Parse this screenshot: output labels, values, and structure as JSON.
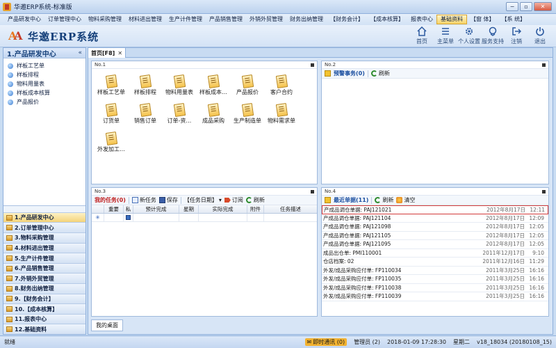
{
  "window": {
    "title": "华邀ERP系统-标准版",
    "buttons": [
      "−",
      "▫",
      "✕"
    ]
  },
  "menu": [
    {
      "label": "产品研发中心",
      "active": false
    },
    {
      "label": "订单管理中心",
      "active": false
    },
    {
      "label": "物料采购管理",
      "active": false
    },
    {
      "label": "材料进出管理",
      "active": false
    },
    {
      "label": "生产计件管理",
      "active": false
    },
    {
      "label": "产品销售管理",
      "active": false
    },
    {
      "label": "外销外贸管理",
      "active": false
    },
    {
      "label": "财务出纳管理",
      "active": false
    },
    {
      "label": "【财务会计】",
      "active": false
    },
    {
      "label": "【成本核算】",
      "active": false
    },
    {
      "label": "报表中心",
      "active": false
    },
    {
      "label": "基础资料",
      "active": true
    },
    {
      "label": "【窗 体】",
      "active": false
    },
    {
      "label": "【系 统】",
      "active": false
    }
  ],
  "logo": {
    "text": "华邀ERP系统"
  },
  "toolbar": [
    {
      "label": "首页",
      "icon": "home-icon"
    },
    {
      "label": "主菜单",
      "icon": "menu-icon"
    },
    {
      "label": "个人设置",
      "icon": "gear-icon"
    },
    {
      "label": "服务支持",
      "icon": "support-icon"
    },
    {
      "label": "注销",
      "icon": "logout-icon"
    },
    {
      "label": "退出",
      "icon": "power-icon"
    }
  ],
  "sidebar": {
    "title": "1.产品研发中心",
    "collapse": "«",
    "tree": [
      "样板工艺单",
      "样板排程",
      "物料用量表",
      "样板成本核算",
      "产品报价"
    ],
    "categories": [
      {
        "label": "1.产品研发中心",
        "active": true
      },
      {
        "label": "2.订单管理中心",
        "active": false
      },
      {
        "label": "3.物料采购管理",
        "active": false
      },
      {
        "label": "4.材料进出管理",
        "active": false
      },
      {
        "label": "5.生产计件管理",
        "active": false
      },
      {
        "label": "6.产品销售管理",
        "active": false
      },
      {
        "label": "7.外销外贸管理",
        "active": false
      },
      {
        "label": "8.财务出纳管理",
        "active": false
      },
      {
        "label": "9.【财务会计】",
        "active": false
      },
      {
        "label": "10.【成本核算】",
        "active": false
      },
      {
        "label": "11.报表中心",
        "active": false
      },
      {
        "label": "12.基础资料",
        "active": false
      }
    ]
  },
  "tab": {
    "label": "首页[F8]",
    "close": "✕"
  },
  "panel1": {
    "title": "No.1",
    "icons": [
      "样板工艺单",
      "样板排程",
      "物料用量表",
      "样板成本…",
      "产品报价",
      "客户合约",
      "订货单",
      "销售订单",
      "订单-资…",
      "成品采购",
      "生产制造单",
      "物料需求单",
      "外发加工…"
    ]
  },
  "panel2": {
    "title": "No.2",
    "caption": "预警事务(0)",
    "refresh": "刷新"
  },
  "panel3": {
    "title": "No.3",
    "caption": "我的任务(0)",
    "new_task": "新任务",
    "save": "保存",
    "date_filter": "【任务日期】",
    "subscribe": "订阅",
    "refresh": "刷新",
    "columns": [
      "重要",
      "私",
      "预计完成",
      "星期",
      "实际完成",
      "附件",
      "任务描述"
    ],
    "new_row_marker": "✳"
  },
  "panel4": {
    "title": "No.4",
    "caption": "最近单据(11)",
    "refresh": "刷新",
    "clear": "清空",
    "rows": [
      {
        "name": "产成品调仓单据: PAJ121021",
        "date": "2012年8月17日",
        "time": "12:11"
      },
      {
        "name": "产成品调仓单据: PAJ121104",
        "date": "2012年8月17日",
        "time": "12:09"
      },
      {
        "name": "产成品调仓单据: PAJ121098",
        "date": "2012年8月17日",
        "time": "12:05"
      },
      {
        "name": "产成品调仓单据: PAJ121105",
        "date": "2012年8月17日",
        "time": "12:05"
      },
      {
        "name": "产成品调仓单据: PAJ121095",
        "date": "2012年8月17日",
        "time": "12:05"
      },
      {
        "name": "成品出仓单: PMI110001",
        "date": "2011年12月17日",
        "time": "9:10"
      },
      {
        "name": "仓店档案: 02",
        "date": "2011年12月16日",
        "time": "11:29"
      },
      {
        "name": "外发/成品采购应付单: FP110034",
        "date": "2011年3月25日",
        "time": "16:16"
      },
      {
        "name": "外发/成品采购应付单: FP110035",
        "date": "2011年3月25日",
        "time": "16:16"
      },
      {
        "name": "外发/成品采购应付单: FP110038",
        "date": "2011年3月25日",
        "time": "16:16"
      },
      {
        "name": "外发/成品采购应付单: FP110039",
        "date": "2011年3月25日",
        "time": "16:16"
      }
    ]
  },
  "desktop_tab": "我的桌面",
  "status": {
    "left": "就绪",
    "im": "即时通讯 (0)",
    "user": "管理员 (2)",
    "datetime": "2018-01-09  17:28:30",
    "weekday": "星期二",
    "version": "v18_18034 (20180108_15)"
  }
}
